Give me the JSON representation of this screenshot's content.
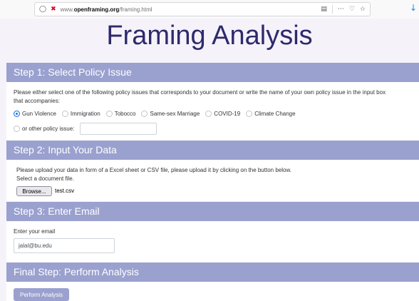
{
  "browser": {
    "url_prefix": "www.",
    "url_domain": "openframing.org",
    "url_path": "/framing.html",
    "icons": [
      "shield-icon",
      "tracker-icon",
      "reader-icon",
      "more-icon",
      "pocket-icon",
      "bookmark-star-icon",
      "download-icon"
    ]
  },
  "page": {
    "title": "Framing Analysis"
  },
  "step1": {
    "heading": "Step 1: Select Policy Issue",
    "instructions_line1": "Please either select one of the following policy issues that corresponds to your document or write the name of your own policy issue in the input box",
    "instructions_line2": "that accompanies:",
    "options": [
      "Gun Violence",
      "Immigration",
      "Tobocco",
      "Same-sex Marriage",
      "COVID-19",
      "Climate Change"
    ],
    "selected": "Gun Violence",
    "other_label": "or other policy issue:",
    "other_value": ""
  },
  "step2": {
    "heading": "Step 2: Input Your Data",
    "line1": "Please upload your data in form of a Excel sheet or CSV file, please upload it by clicking on the button below.",
    "line2": "Select a document file.",
    "browse_label": "Browse...",
    "file_name": "test.csv"
  },
  "step3": {
    "heading": "Step 3: Enter Email",
    "label": "Enter your email",
    "email_value": "jalal@bu.edu"
  },
  "final": {
    "heading": "Final Step: Perform Analysis",
    "button_label": "Perform Analysis"
  },
  "colors": {
    "accent": "#9aa1cf",
    "title": "#2d2a6b",
    "radio_selected": "#1a73e8",
    "background": "#f6f2fa"
  }
}
